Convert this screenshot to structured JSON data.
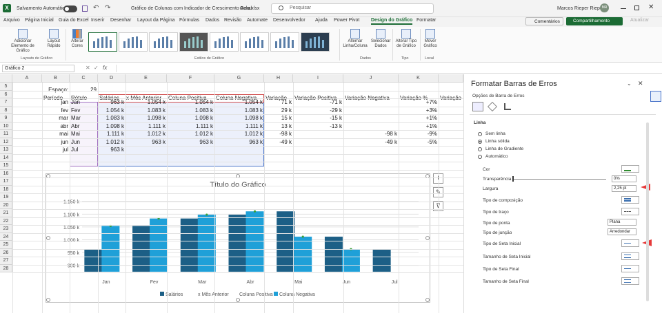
{
  "titlebar": {
    "autosave": "Salvamento Automático",
    "filename": "Gráfico de Colunas com Indicador de Crescimento Aula.xlsx",
    "sensitivity": "Geral",
    "search_placeholder": "Pesquisar",
    "user": "Marcos Rieper Rieper",
    "avatar": "MR"
  },
  "tabs": [
    "Arquivo",
    "Página Inicial",
    "Guia do Excel",
    "Inserir",
    "Desenhar",
    "Layout da Página",
    "Fórmulas",
    "Dados",
    "Revisão",
    "Automate",
    "Desenvolvedor",
    "Ajuda",
    "Power Pivot",
    "Design do Gráfico",
    "Formatar"
  ],
  "actions": {
    "comments": "Comentários",
    "share": "Compartilhamento",
    "catchup": "Atualizar"
  },
  "ribbon": {
    "add_element": "Adicionar Elemento de Gráfico",
    "quick_layout": "Layout Rápido",
    "change_colors": "Alterar Cores",
    "switch": "Alternar Linha/Coluna",
    "select_data": "Selecionar Dados",
    "change_type": "Alterar Tipo de Gráfico",
    "move": "Mover Gráfico",
    "groups": {
      "layouts": "Layouts de Gráfico",
      "styles": "Estilos de Gráfico",
      "data": "Dados",
      "type": "Tipo",
      "local": "Local"
    }
  },
  "namebox": "Gráfico 2",
  "columns": [
    "A",
    "B",
    "C",
    "D",
    "E",
    "F",
    "G",
    "H",
    "I",
    "J",
    "K"
  ],
  "rows": [
    "5",
    "6",
    "7",
    "8",
    "9",
    "10",
    "11",
    "12",
    "13",
    "14",
    "15",
    "16",
    "17",
    "18",
    "19",
    "20",
    "21",
    "22",
    "23",
    "24",
    "25",
    "26",
    "27",
    "28"
  ],
  "sheet": {
    "espaco_label": "Espaço:",
    "espaco_value": "29",
    "headers": [
      "Período",
      "Rótulo",
      "Salários",
      "x Mês Anterior",
      "Coluna Positiva",
      "Coluna Negativa",
      "Variação",
      "Variação Positiva",
      "Variação Negativa",
      "Variação %",
      "Variação"
    ],
    "data": [
      [
        "jan",
        "Jan",
        "963 k",
        "1.054 k",
        "1.054 k",
        "1.054 k",
        "71 k",
        "-71 k",
        "",
        "+7%"
      ],
      [
        "fev",
        "Fev",
        "1.054 k",
        "1.083 k",
        "1.083 k",
        "1.083 k",
        "29 k",
        "-29 k",
        "",
        "+3%"
      ],
      [
        "mar",
        "Mar",
        "1.083 k",
        "1.098 k",
        "1.098 k",
        "1.098 k",
        "15 k",
        "-15 k",
        "",
        "+1%"
      ],
      [
        "abr",
        "Abr",
        "1.098 k",
        "1.111 k",
        "1.111 k",
        "1.111 k",
        "13 k",
        "-13 k",
        "",
        "+1%"
      ],
      [
        "mai",
        "Mai",
        "1.111 k",
        "1.012 k",
        "1.012 k",
        "1.012 k",
        "-98 k",
        "",
        "-98 k",
        "-9%"
      ],
      [
        "jun",
        "Jun",
        "1.012 k",
        "963 k",
        "963 k",
        "963 k",
        "-49 k",
        "",
        "-49 k",
        "-5%"
      ],
      [
        "jul",
        "Jul",
        "963 k",
        "",
        "",
        "",
        "",
        "",
        "",
        ""
      ]
    ]
  },
  "chart_data": {
    "type": "bar",
    "title": "Título do Gráfico",
    "categories": [
      "Jan",
      "Fev",
      "Mar",
      "Abr",
      "Mai",
      "Jun",
      "Jul"
    ],
    "yticks": [
      "1.150 k",
      "1.100 k",
      "1.050 k",
      "1.000 k",
      "950 k",
      "900 k"
    ],
    "ylim": [
      875,
      1160
    ],
    "series": [
      {
        "name": "Salários",
        "values": [
          963,
          1054,
          1083,
          1098,
          1111,
          1012,
          963
        ],
        "color": "#1c5f86"
      },
      {
        "name": "Coluna Positiva",
        "values": [
          1054,
          1083,
          1098,
          1111,
          null,
          null,
          null
        ],
        "color": "#1fa0d8"
      },
      {
        "name": "Coluna Negativa",
        "values": [
          null,
          null,
          null,
          null,
          1012,
          963,
          null
        ],
        "color": "#1fa0d8"
      }
    ],
    "legend": [
      "Salários",
      "x Mês Anterior",
      "Coluna Positiva",
      "Coluna Negativa"
    ],
    "legend_colors": [
      "#1c5f86",
      "#ffffff",
      "#ffffff",
      "#1fa0d8"
    ],
    "legend_position": "bottom",
    "grid": true
  },
  "pane": {
    "title": "Formatar Barras de Erros",
    "options": "Opções de Barra de Erros",
    "section": "Linha",
    "radios": [
      "Sem linha",
      "Linha sólida",
      "Linha de Gradiente",
      "Automático"
    ],
    "props": [
      "Cor",
      "Transparência",
      "Largura",
      "Tipo de composição",
      "Tipo de traço",
      "Tipo de ponta",
      "Tipo de junção",
      "Tipo de Seta Inicial",
      "Tamanho de Seta Inicial",
      "Tipo de Seta Final",
      "Tamanho de Seta Final"
    ],
    "transparency": "0%",
    "width": "2,25 pt",
    "cap": "Plana",
    "join": "Arredondar"
  }
}
